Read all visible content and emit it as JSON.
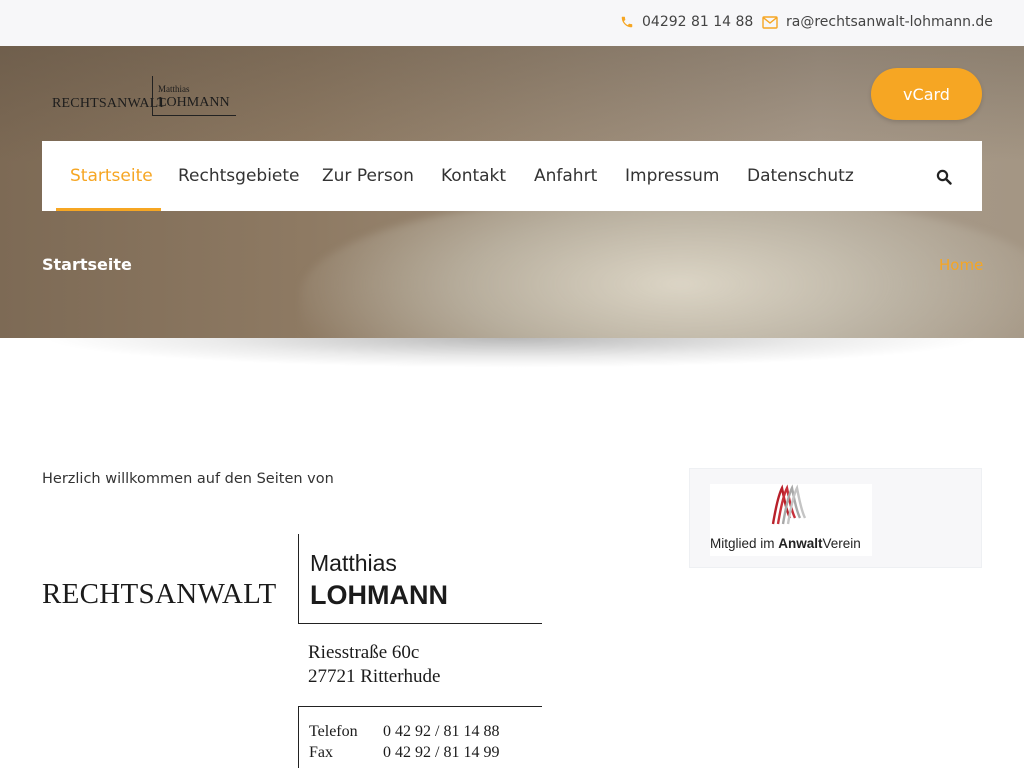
{
  "topbar": {
    "phone": "04292 81 14 88",
    "email": "ra@rechtsanwalt-lohmann.de",
    "phone_icon": "phone-icon",
    "email_icon": "envelope-icon"
  },
  "header": {
    "logo": {
      "word": "RECHTSANWALT",
      "first_name": "Matthias",
      "last_name": "LOHMANN"
    },
    "vcard_label": "vCard"
  },
  "nav": {
    "items": [
      {
        "label": "Startseite",
        "active": true
      },
      {
        "label": "Rechtsgebiete"
      },
      {
        "label": "Zur Person"
      },
      {
        "label": "Kontakt"
      },
      {
        "label": "Anfahrt"
      },
      {
        "label": "Impressum"
      },
      {
        "label": "Datenschutz"
      }
    ],
    "search_icon": "search-icon"
  },
  "page": {
    "title": "Startseite",
    "breadcrumb_home": "Home"
  },
  "main": {
    "welcome": "Herzlich willkommen auf den Seiten von",
    "letterhead": {
      "word": "RECHTSANWALT",
      "first_name": "Matthias",
      "last_name": "LOHMANN",
      "street": "Riesstraße 60c",
      "city": "27721 Ritterhude",
      "tel_label": "Telefon",
      "tel_value": "0 42 92 / 81 14 88",
      "fax_label": "Fax",
      "fax_value": "0 42 92 / 81 14 99"
    }
  },
  "sidebar": {
    "badge_prefix": "Mitglied im ",
    "badge_bold": "Anwalt",
    "badge_suffix": "Verein"
  },
  "colors": {
    "accent": "#f6a623",
    "topbar_bg": "#f7f7f9",
    "text": "#333333"
  }
}
